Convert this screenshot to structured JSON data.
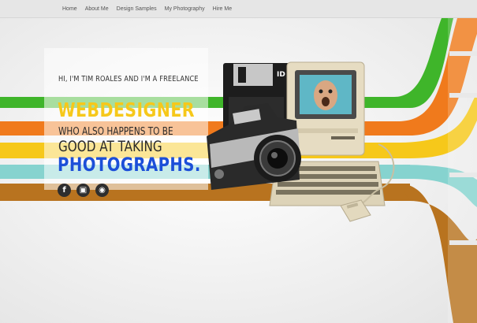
{
  "nav": {
    "items": [
      {
        "label": "Home"
      },
      {
        "label": "About Me"
      },
      {
        "label": "Design Samples"
      },
      {
        "label": "My Photography"
      },
      {
        "label": "Hire Me"
      }
    ]
  },
  "hero": {
    "line1": "HI, I'M TIM ROALES AND I'M A FREELANCE",
    "line2": "WEBDESIGNER",
    "line3": "WHO ALSO HAPPENS TO BE",
    "line4": "GOOD AT TAKING",
    "line5": "PHOTOGRAPHS."
  },
  "social": [
    {
      "icon": "facebook-icon",
      "glyph": "f"
    },
    {
      "icon": "computer-icon",
      "glyph": "▣"
    },
    {
      "icon": "camera-icon",
      "glyph": "◉"
    }
  ],
  "colors": {
    "green": "#3fb52a",
    "orange": "#f07a1c",
    "yellow": "#f6c81a",
    "teal": "#86d3cf",
    "brown": "#b8731f",
    "blue": "#1c4fd8"
  }
}
